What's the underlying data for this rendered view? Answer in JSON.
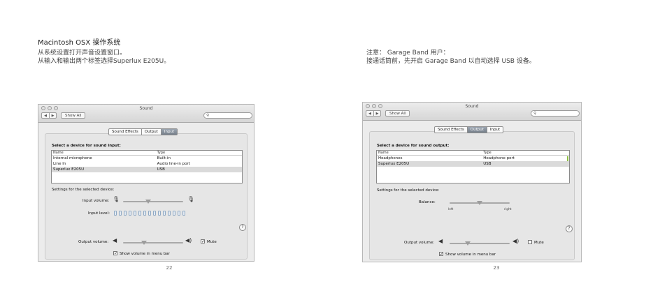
{
  "left_text": {
    "heading": "Macintosh OSX 操作系统",
    "line1": "从系统设置打开声音设置窗口。",
    "line2": "从输入和输出两个标签选择Superlux E205U。"
  },
  "right_text": {
    "line1": "注意：  Garage Band 用户：",
    "line2": "接通话筒前，先开启 Garage Band 以自动选择 USB 设备。"
  },
  "page_numbers": {
    "left": "22",
    "right": "23"
  },
  "window_common": {
    "title": "Sound",
    "back": "◀",
    "forward": "▶",
    "show_all": "Show All",
    "tabs": [
      "Sound Effects",
      "Output",
      "Input"
    ],
    "col_name": "Name",
    "col_type": "Type",
    "settings_label": "Settings for the selected device:",
    "output_volume_label": "Output volume:",
    "mute_label": "Mute",
    "show_volume_label": "Show volume in menu bar",
    "help": "?"
  },
  "input_window": {
    "active_tab": "Input",
    "select_title": "Select a device for sound input:",
    "rows": [
      {
        "name": "Internal microphone",
        "type": "Built-in"
      },
      {
        "name": "Line In",
        "type": "Audio line-in port"
      },
      {
        "name": "Superlux E205U",
        "type": "USB"
      }
    ],
    "selected_row": 2,
    "input_volume_label": "Input volume:",
    "input_level_label": "Input level:",
    "input_level_leds": 15,
    "input_volume_level": 0.42,
    "output_volume_level": 0.35,
    "mute_checked": true,
    "show_volume_checked": true
  },
  "output_window": {
    "active_tab": "Output",
    "select_title": "Select a device for sound output:",
    "rows": [
      {
        "name": "Headphones",
        "type": "Headphone port"
      },
      {
        "name": "Superlux E205U",
        "type": "USB"
      }
    ],
    "selected_row": 1,
    "balance_label": "Balance:",
    "left_label": "left",
    "right_label": "right",
    "balance_level": 0.5,
    "output_volume_level": 0.3,
    "mute_checked": false,
    "show_volume_checked": true
  }
}
